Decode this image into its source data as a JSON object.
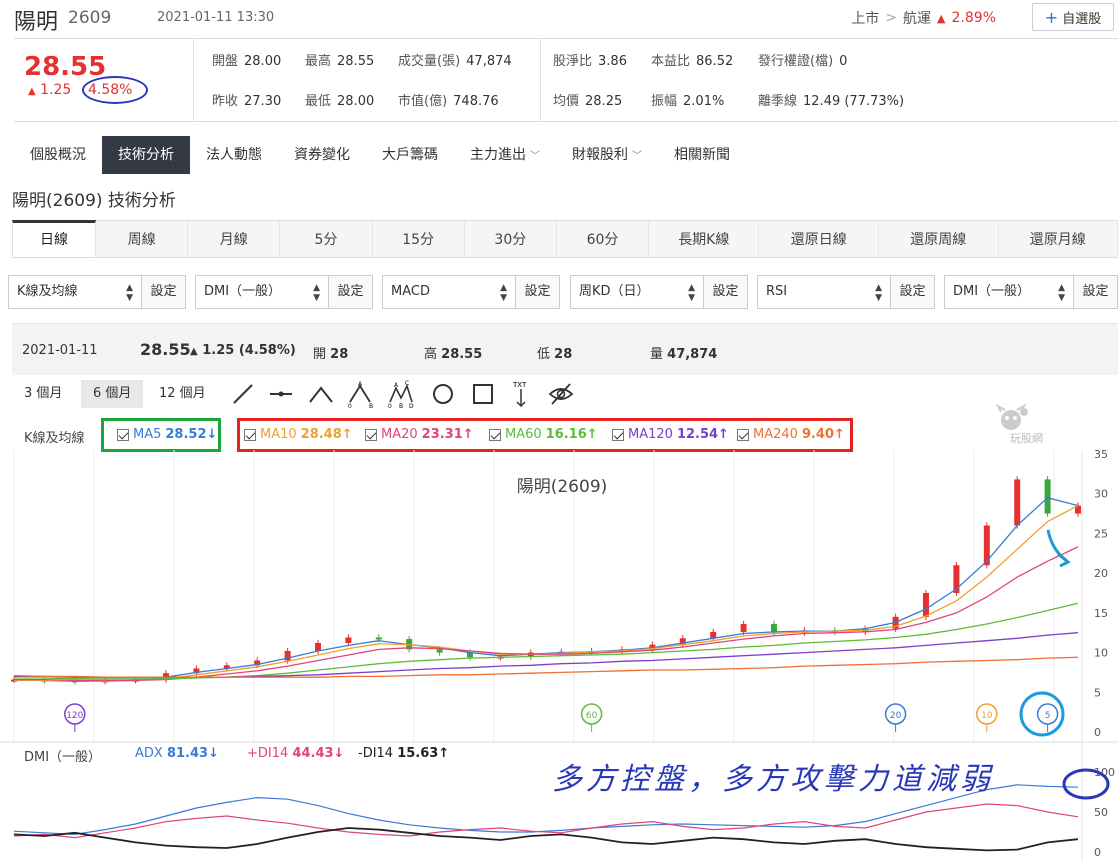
{
  "header": {
    "stock_name": "陽明",
    "stock_code": "2609",
    "datetime": "2021-01-11 13:30",
    "market": "上市",
    "separator": ">",
    "industry": "航運",
    "change_percent": "2.89%",
    "watch_button": "自選股"
  },
  "quote": {
    "price": "28.55",
    "change": "1.25",
    "change_percent": "4.58%",
    "stats": [
      {
        "label": "開盤",
        "value": "28.00"
      },
      {
        "label": "最高",
        "value": "28.55"
      },
      {
        "label": "成交量(張)",
        "value": "47,874"
      },
      {
        "label": "股淨比",
        "value": "3.86"
      },
      {
        "label": "本益比",
        "value": "86.52"
      },
      {
        "label": "發行權證(檔)",
        "value": "0"
      },
      {
        "label": "昨收",
        "value": "27.30"
      },
      {
        "label": "最低",
        "value": "28.00"
      },
      {
        "label": "市值(億)",
        "value": "748.76"
      },
      {
        "label": "均價",
        "value": "28.25"
      },
      {
        "label": "振幅",
        "value": "2.01%"
      },
      {
        "label": "離季線",
        "value": "12.49 (77.73%)"
      }
    ]
  },
  "main_tabs": [
    "個股概況",
    "技術分析",
    "法人動態",
    "資券變化",
    "大戶籌碼",
    "主力進出",
    "財報股利",
    "相關新聞"
  ],
  "section_title": "陽明(2609) 技術分析",
  "period_tabs": [
    "日線",
    "周線",
    "月線",
    "5分",
    "15分",
    "30分",
    "60分",
    "長期K線",
    "還原日線",
    "還原周線",
    "還原月線"
  ],
  "selectors": [
    {
      "value": "K線及均線",
      "set": "設定"
    },
    {
      "value": "DMI（一般）",
      "set": "設定"
    },
    {
      "value": "MACD",
      "set": "設定"
    },
    {
      "value": "周KD（日）",
      "set": "設定"
    },
    {
      "value": "RSI",
      "set": "設定"
    },
    {
      "value": "DMI（一般）",
      "set": "設定"
    }
  ],
  "info_bar": {
    "date": "2021-01-11",
    "price": "28.55",
    "change": "1.25 (4.58%)",
    "open_label": "開",
    "open": "28",
    "high_label": "高",
    "high": "28.55",
    "low_label": "低",
    "low": "28",
    "vol_label": "量",
    "vol": "47,874"
  },
  "range_buttons": [
    "3 個月",
    "6 個月",
    "12 個月"
  ],
  "ma_legend": {
    "label": "K線及均線",
    "items": [
      {
        "name": "MA5",
        "value": "28.52↓",
        "color": "#3a7bd5"
      },
      {
        "name": "MA10",
        "value": "28.48↑",
        "color": "#f0a030"
      },
      {
        "name": "MA20",
        "value": "23.31↑",
        "color": "#e0447a"
      },
      {
        "name": "MA60",
        "value": "16.16↑",
        "color": "#5dbb3a"
      },
      {
        "name": "MA120",
        "value": "12.54↑",
        "color": "#7b3fc9"
      },
      {
        "name": "MA240",
        "value": "9.40↑",
        "color": "#f07030"
      }
    ]
  },
  "chart_title": "陽明(2609)",
  "watermark": "玩股網",
  "dmi_legend": {
    "label": "DMI（一般）",
    "items": [
      {
        "name": "ADX",
        "value": "81.43↓",
        "color": "#3a7bd5"
      },
      {
        "name": "+DI14",
        "value": "44.43↓",
        "color": "#e0447a"
      },
      {
        "name": "-DI14",
        "value": "15.63↑",
        "color": "#222222"
      }
    ]
  },
  "annotation": "多方控盤，多方攻擊力道減弱",
  "chart_data": [
    {
      "type": "line",
      "title": "陽明(2609)",
      "y_ticks": [
        "35",
        "30",
        "25",
        "20",
        "15",
        "10",
        "5",
        "0"
      ],
      "ylim": [
        0,
        35
      ],
      "ma_markers": [
        "120",
        "60",
        "20",
        "10",
        "5"
      ],
      "series": [
        {
          "name": "MA5",
          "color": "#3a7bd5",
          "values": [
            6.5,
            6.5,
            6.4,
            6.4,
            6.5,
            6.9,
            7.5,
            8.0,
            8.5,
            9.3,
            10.2,
            10.9,
            11.5,
            11.0,
            10.6,
            10.0,
            9.6,
            9.8,
            10.0,
            10.1,
            10.3,
            10.6,
            11.2,
            11.8,
            12.4,
            12.6,
            12.7,
            12.7,
            13.0,
            13.8,
            15.5,
            18.0,
            21.5,
            26.0,
            29.5,
            28.5
          ]
        },
        {
          "name": "MA10",
          "color": "#f0a030",
          "values": [
            6.5,
            6.5,
            6.5,
            6.4,
            6.5,
            6.7,
            7.2,
            7.7,
            8.2,
            8.9,
            9.7,
            10.5,
            11.1,
            11.0,
            10.7,
            10.2,
            9.8,
            9.8,
            9.9,
            10.1,
            10.2,
            10.5,
            11.0,
            11.5,
            12.1,
            12.4,
            12.6,
            12.7,
            12.8,
            13.3,
            14.6,
            16.5,
            19.5,
            23.0,
            26.5,
            28.5
          ]
        },
        {
          "name": "MA20",
          "color": "#e0447a",
          "values": [
            6.6,
            6.6,
            6.5,
            6.5,
            6.5,
            6.6,
            6.9,
            7.3,
            7.7,
            8.3,
            9.0,
            9.7,
            10.4,
            10.6,
            10.5,
            10.2,
            9.9,
            9.8,
            9.8,
            9.9,
            10.1,
            10.3,
            10.7,
            11.2,
            11.7,
            12.1,
            12.4,
            12.5,
            12.6,
            12.9,
            13.8,
            15.0,
            17.0,
            19.5,
            21.5,
            23.3
          ]
        },
        {
          "name": "MA60",
          "color": "#5dbb3a",
          "values": [
            6.8,
            6.8,
            6.7,
            6.7,
            6.7,
            6.7,
            6.8,
            6.9,
            7.1,
            7.4,
            7.8,
            8.2,
            8.6,
            8.9,
            9.1,
            9.3,
            9.4,
            9.5,
            9.6,
            9.7,
            9.8,
            10.0,
            10.2,
            10.4,
            10.7,
            10.9,
            11.2,
            11.4,
            11.6,
            11.9,
            12.3,
            12.9,
            13.6,
            14.4,
            15.3,
            16.2
          ]
        },
        {
          "name": "MA120",
          "color": "#7b3fc9",
          "values": [
            7.0,
            7.0,
            6.9,
            6.9,
            6.9,
            6.9,
            6.9,
            6.9,
            7.0,
            7.1,
            7.2,
            7.4,
            7.6,
            7.8,
            8.0,
            8.1,
            8.3,
            8.4,
            8.6,
            8.7,
            8.9,
            9.0,
            9.2,
            9.4,
            9.6,
            9.8,
            10.0,
            10.2,
            10.4,
            10.6,
            10.9,
            11.2,
            11.5,
            11.8,
            12.2,
            12.5
          ]
        },
        {
          "name": "MA240",
          "color": "#f07030",
          "values": [
            7.1,
            7.0,
            7.0,
            6.9,
            6.9,
            6.9,
            6.9,
            6.9,
            6.9,
            6.9,
            6.9,
            7.0,
            7.0,
            7.1,
            7.2,
            7.2,
            7.3,
            7.4,
            7.5,
            7.6,
            7.7,
            7.8,
            7.8,
            7.9,
            8.0,
            8.1,
            8.3,
            8.4,
            8.5,
            8.6,
            8.8,
            8.9,
            9.0,
            9.1,
            9.3,
            9.4
          ]
        },
        {
          "name": "K線",
          "color": "#e4312f",
          "values": [
            6.6,
            6.5,
            6.4,
            6.5,
            6.6,
            7.4,
            8.0,
            8.4,
            9.0,
            10.2,
            11.2,
            11.9,
            11.7,
            10.4,
            10.0,
            9.4,
            9.5,
            10.0,
            10.1,
            10.2,
            10.4,
            11.0,
            11.8,
            12.6,
            13.6,
            12.5,
            12.8,
            12.6,
            13.0,
            14.5,
            17.5,
            21.0,
            26.0,
            31.8,
            27.5,
            28.5
          ]
        }
      ]
    },
    {
      "type": "line",
      "title": "DMI（一般）",
      "y_ticks": [
        "100",
        "50",
        "0"
      ],
      "ylim": [
        0,
        100
      ],
      "series": [
        {
          "name": "ADX",
          "color": "#3a7bd5",
          "values": [
            26,
            24,
            22,
            28,
            35,
            45,
            55,
            62,
            68,
            66,
            58,
            48,
            40,
            34,
            30,
            27,
            25,
            25,
            27,
            30,
            32,
            34,
            35,
            34,
            33,
            32,
            31,
            33,
            38,
            48,
            58,
            68,
            78,
            84,
            82,
            81
          ]
        },
        {
          "name": "+DI14",
          "color": "#e0447a",
          "values": [
            20,
            22,
            18,
            24,
            30,
            38,
            42,
            45,
            40,
            36,
            30,
            25,
            22,
            20,
            25,
            28,
            30,
            26,
            24,
            30,
            35,
            38,
            32,
            28,
            30,
            35,
            38,
            32,
            30,
            40,
            50,
            55,
            60,
            58,
            50,
            44
          ]
        },
        {
          "name": "-DI14",
          "color": "#222222",
          "values": [
            22,
            20,
            24,
            18,
            12,
            8,
            6,
            5,
            10,
            18,
            25,
            30,
            28,
            24,
            20,
            18,
            15,
            20,
            22,
            18,
            12,
            10,
            14,
            18,
            16,
            12,
            10,
            14,
            16,
            10,
            6,
            4,
            2,
            3,
            12,
            16
          ]
        }
      ]
    }
  ]
}
